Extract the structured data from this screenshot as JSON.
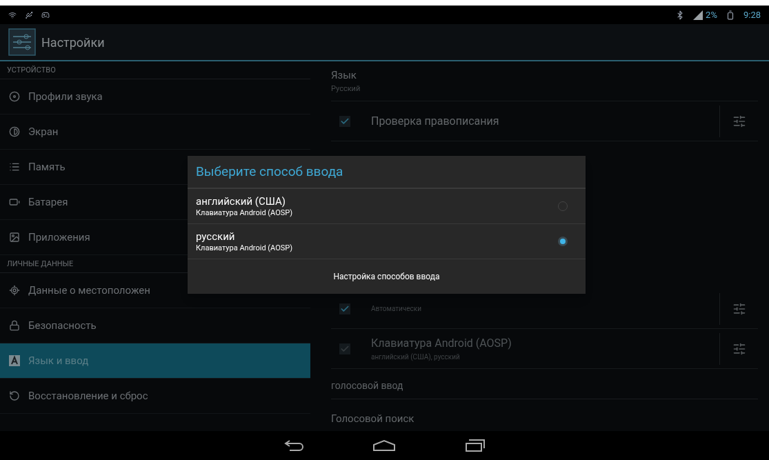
{
  "status_bar": {
    "battery_percent": "2%",
    "time": "9:28"
  },
  "action_bar": {
    "title": "Настройки"
  },
  "sidebar": [
    {
      "kind": "header",
      "label": "УСТРОЙСТВО"
    },
    {
      "kind": "item",
      "label": "Профили звука",
      "selected": false
    },
    {
      "kind": "item",
      "label": "Экран",
      "selected": false
    },
    {
      "kind": "item",
      "label": "Память",
      "selected": false
    },
    {
      "kind": "item",
      "label": "Батарея",
      "selected": false
    },
    {
      "kind": "item",
      "label": "Приложения",
      "selected": false
    },
    {
      "kind": "header",
      "label": "ЛИЧНЫЕ ДАННЫЕ"
    },
    {
      "kind": "item",
      "label": "Данные о местоположен",
      "selected": false
    },
    {
      "kind": "item",
      "label": "Безопасность",
      "selected": false
    },
    {
      "kind": "item",
      "label": "Язык и ввод",
      "selected": true
    },
    {
      "kind": "item",
      "label": "Восстановление и сброс",
      "selected": false
    }
  ],
  "settings": [
    {
      "kind": "plain",
      "title": "Язык",
      "summary": "Русский"
    },
    {
      "kind": "check",
      "title": "Проверка правописания",
      "checked": true,
      "disabled": false
    },
    {
      "kind": "hidden"
    },
    {
      "kind": "check",
      "summary": "Автоматически",
      "checked": true,
      "disabled": false
    },
    {
      "kind": "check",
      "title": "Клавиатура Android (AOSP)",
      "summary": "английский (США), русский",
      "checked": true,
      "disabled": true
    },
    {
      "kind": "header",
      "title": "голосовой ввод"
    },
    {
      "kind": "plain",
      "title": "Голосовой поиск"
    }
  ],
  "dialog": {
    "title": "Выберите способ ввода",
    "options": [
      {
        "label": "английский (США)",
        "summary": "Клавиатура Android (AOSP)",
        "selected": false
      },
      {
        "label": "русский",
        "summary": "Клавиатура Android (AOSP)",
        "selected": true
      }
    ],
    "button": "Настройка способов ввода"
  }
}
